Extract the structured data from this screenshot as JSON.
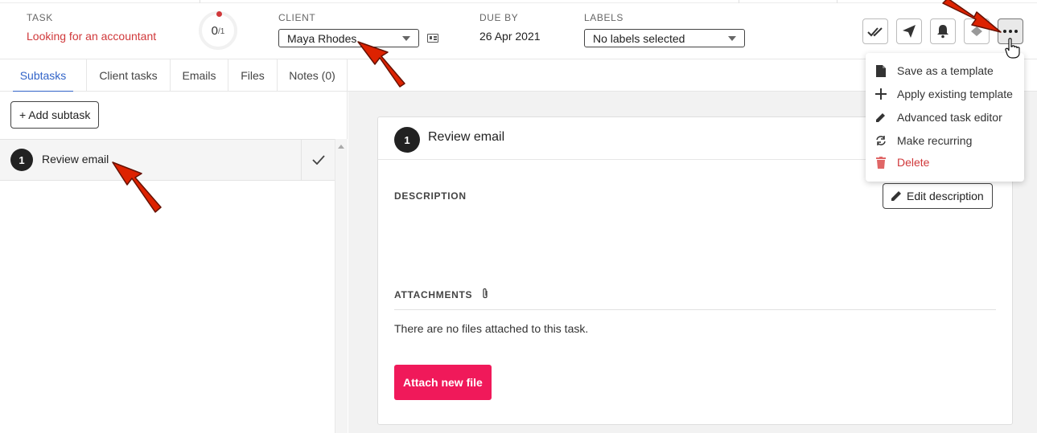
{
  "header": {
    "task_label": "TASK",
    "task_title": "Looking for an accountant",
    "progress_done": "0",
    "progress_total": "/1",
    "client_label": "CLIENT",
    "client_value": "Maya Rhodes",
    "due_label": "DUE BY",
    "due_value": "26 Apr 2021",
    "labels_label": "LABELS",
    "labels_value": "No labels selected",
    "action_icons": [
      "double-check-icon",
      "send-icon",
      "bell-icon",
      "hidden-icon",
      "more-icon"
    ]
  },
  "tabs": [
    {
      "label": "Subtasks",
      "active": true
    },
    {
      "label": "Client tasks"
    },
    {
      "label": "Emails"
    },
    {
      "label": "Files"
    },
    {
      "label": "Notes (0)"
    }
  ],
  "left": {
    "add_subtask": "+ Add subtask",
    "subtasks": [
      {
        "number": "1",
        "label": "Review email"
      }
    ]
  },
  "card": {
    "number": "1",
    "title": "Review email",
    "description_label": "DESCRIPTION",
    "edit_description": "Edit description",
    "attachments_label": "ATTACHMENTS",
    "no_files": "There are no files attached to this task.",
    "attach_button": "Attach new file"
  },
  "menu": {
    "items": [
      {
        "label": "Save as a template",
        "icon": "document-icon"
      },
      {
        "label": "Apply existing template",
        "icon": "plus-icon"
      },
      {
        "label": "Advanced task editor",
        "icon": "pencil-icon"
      },
      {
        "label": "Make recurring",
        "icon": "recurring-icon"
      },
      {
        "label": "Delete",
        "icon": "trash-icon"
      }
    ]
  },
  "colors": {
    "accent_red": "#d0383a",
    "tab_active": "#3264c8",
    "attach_button": "#f0195a",
    "annotation_arrow": "#dd2200"
  }
}
